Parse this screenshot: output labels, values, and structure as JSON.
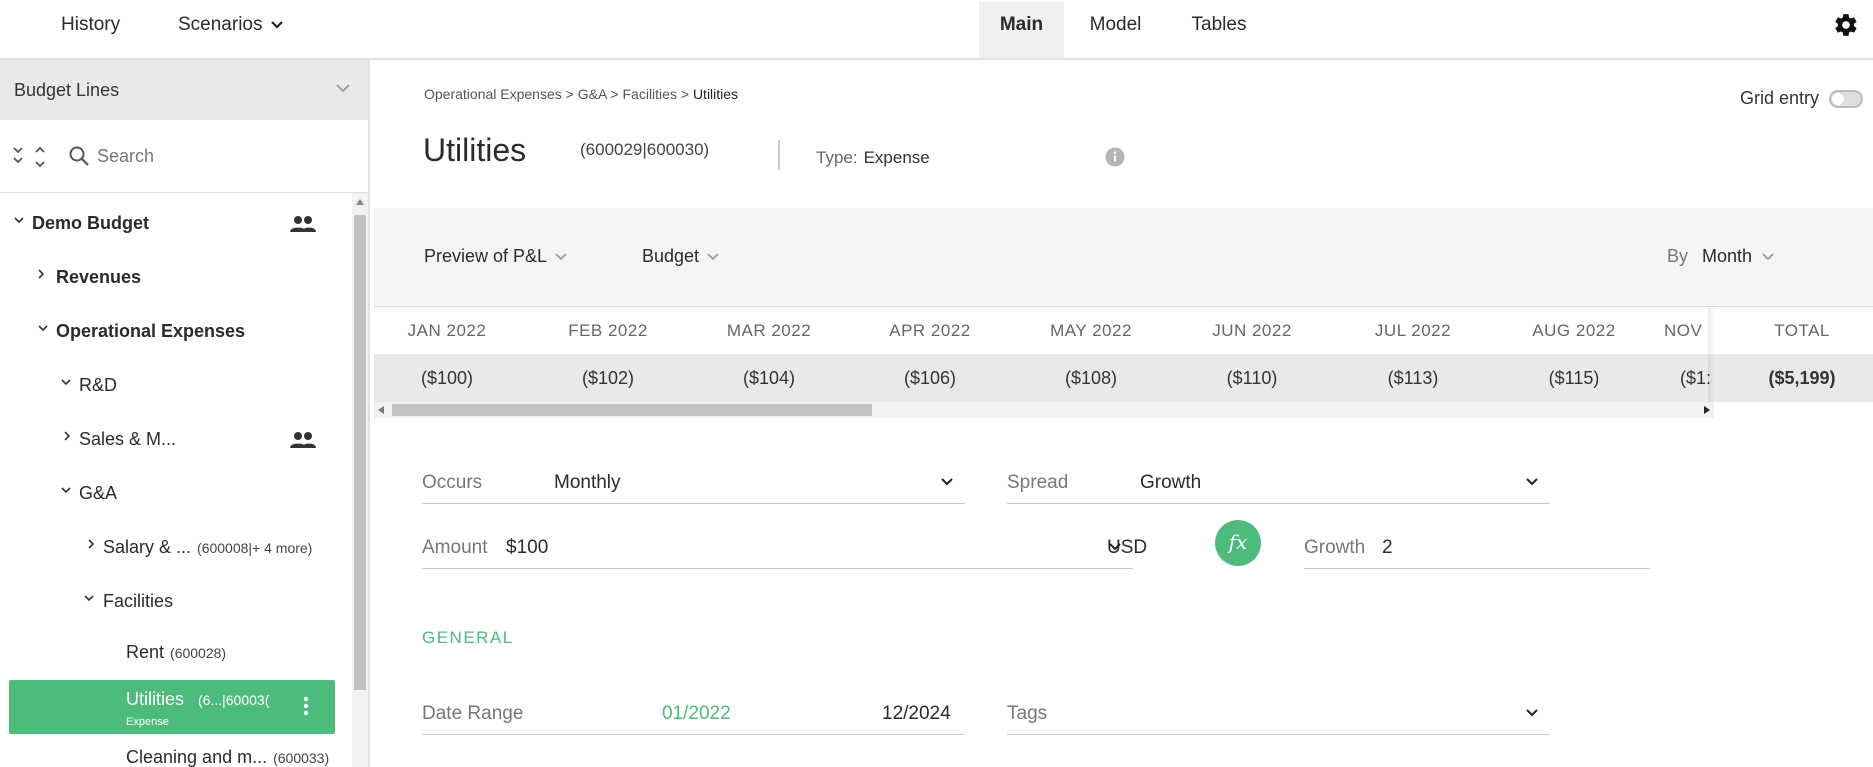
{
  "nav": {
    "history": "History",
    "scenarios": "Scenarios",
    "tabs": [
      "Main",
      "Model",
      "Tables"
    ]
  },
  "sidebar": {
    "header": "Budget Lines",
    "search_placeholder": "Search",
    "tree": {
      "demo_budget": "Demo Budget",
      "revenues": "Revenues",
      "operational_expenses": "Operational Expenses",
      "rd": "R&D",
      "sales": "Sales & M...",
      "ga": "G&A",
      "salary": "Salary & ...",
      "salary_code": "(600008|+ 4 more)",
      "facilities": "Facilities",
      "rent": "Rent",
      "rent_code": "(600028)",
      "utilities": "Utilities",
      "utilities_code": "(6...|60003(",
      "utilities_type": "Expense",
      "cleaning": "Cleaning and m...",
      "cleaning_code": "(600033)"
    }
  },
  "main": {
    "breadcrumb": [
      "Operational Expenses",
      "G&A",
      "Facilities"
    ],
    "breadcrumb_current": "Utilities",
    "breadcrumb_sep": ">",
    "grid_entry": "Grid entry",
    "title": "Utilities",
    "codes": "(600029|600030)",
    "type_label": "Type:",
    "type_value": "Expense",
    "preview_dropdown": "Preview of P&L",
    "budget_dropdown": "Budget",
    "by_label": "By",
    "by_value": "Month",
    "months": [
      "JAN 2022",
      "FEB 2022",
      "MAR 2022",
      "APR 2022",
      "MAY 2022",
      "JUN 2022",
      "JUL 2022",
      "AUG 2022",
      "NOV"
    ],
    "values": [
      "($100)",
      "($102)",
      "($104)",
      "($106)",
      "($108)",
      "($110)",
      "($113)",
      "($115)",
      "($1:"
    ],
    "total_label": "TOTAL",
    "total_value": "($5,199)",
    "occurs_label": "Occurs",
    "occurs_value": "Monthly",
    "spread_label": "Spread",
    "spread_value": "Growth",
    "amount_label": "Amount",
    "amount_value": "$100",
    "currency": "USD",
    "fx": "fx",
    "growth_label": "Growth",
    "growth_value": "2",
    "section_general": "GENERAL",
    "date_range_label": "Date Range",
    "date_start": "01/2022",
    "date_end": "12/2024",
    "tags_label": "Tags"
  },
  "colors": {
    "accent": "#4dbb7c",
    "sidebar_header": "#e9e9e9"
  }
}
